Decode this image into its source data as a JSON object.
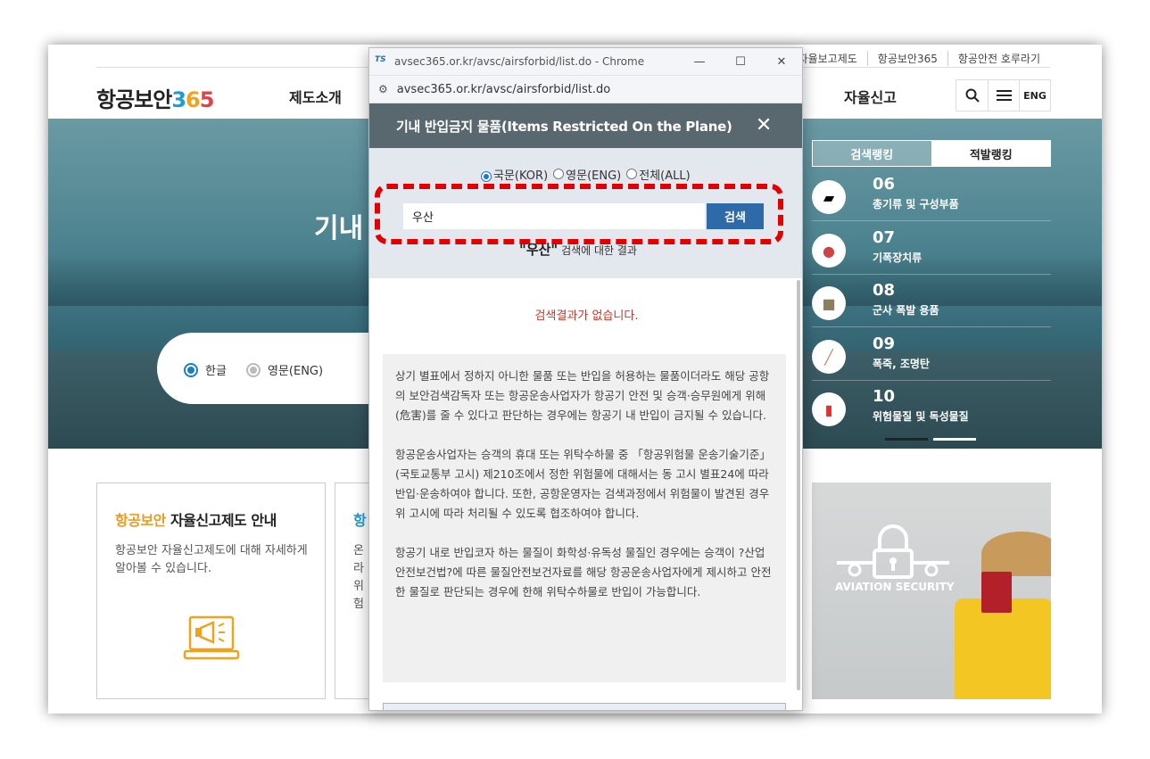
{
  "util_links": [
    "자율보고제도",
    "항공보안365",
    "항공안전 호루라기"
  ],
  "logo": {
    "text": "항공보안",
    "n1": "3",
    "n2": "6",
    "n3": "5"
  },
  "nav": {
    "item1": "제도소개",
    "item2": "자율신고"
  },
  "header_buttons": {
    "lang": "ENG"
  },
  "hero": {
    "title": "기내",
    "radio_korean": "한글",
    "radio_english": "영문(ENG)"
  },
  "ranking": {
    "tab_search": "검색랭킹",
    "tab_detect": "적발랭킹",
    "items": [
      {
        "num": "06",
        "label": "총기류 및 구성부품",
        "icon": "gun-icon"
      },
      {
        "num": "07",
        "label": "기폭장치류",
        "icon": "detonator-icon"
      },
      {
        "num": "08",
        "label": "군사 폭발 용품",
        "icon": "mine-icon"
      },
      {
        "num": "09",
        "label": "폭죽, 조명탄",
        "icon": "firework-icon"
      },
      {
        "num": "10",
        "label": "위험물질 및 독성물질",
        "icon": "hazard-bottle-icon"
      }
    ]
  },
  "cards": [
    {
      "title_accent": "항공보안",
      "title_rest": " 자율신고제도 안내",
      "desc": "항공보안 자율신고제도에 대해 자세하게 알아볼 수 있습니다."
    },
    {
      "title_accent": "항",
      "desc": "온라 위험"
    }
  ],
  "promo": {
    "text": "AVIATION SECURITY"
  },
  "popup": {
    "window_title": "avsec365.or.kr/avsc/airsforbid/list.do - Chrome",
    "window_icon": "TS",
    "url": "avsec365.or.kr/avsc/airsforbid/list.do",
    "header_title": "기내 반입금지 물품(Items Restricted On the Plane)",
    "radio_options": [
      "국문(KOR)",
      "영문(ENG)",
      "전체(ALL)"
    ],
    "selected_radio": "국문(KOR)",
    "search_value": "우산",
    "search_button": "검색",
    "result_keyword": "\"우산\"",
    "result_suffix": "검색에 대한 결과",
    "no_result": "검색결과가 없습니다.",
    "notice_paragraphs": [
      "상기 별표에서 정하지 아니한 물품 또는 반입을 허용하는 물품이더라도 해당 공항의 보안검색감독자 또는 항공운송사업자가 항공기 안전 및 승객·승무원에게 위해(危害)를 줄 수 있다고 판단하는 경우에는 항공기 내 반입이 금지될 수 있습니다.",
      "항공운송사업자는 승객의 휴대 또는 위탁수하물 중 「항공위험물 운송기술기준」(국토교통부 고시) 제210조에서 정한 위험물에 대해서는 동 고시 별표24에 따라 반입·운송하여야 합니다. 또한, 공항운영자는 검색과정에서 위험물이 발견된 경우 위 고시에 따라 처리될 수 있도록 협조하여야 합니다.",
      "항공기 내로 반입코자 하는 물질이 화학성·유독성 물질인 경우에는 승객이 ?산업안전보건법?에 따른 물질안전보건자료를 해당 항공운송사업자에게 제시하고 안전한 물질로 판단되는 경우에 한해 위탁수하물로 반입이 가능합니다."
    ]
  },
  "colors": {
    "accent_blue": "#2f6aa8",
    "header_gray": "#59676f",
    "highlight_red": "#e30000",
    "no_result_red": "#c0392b"
  }
}
